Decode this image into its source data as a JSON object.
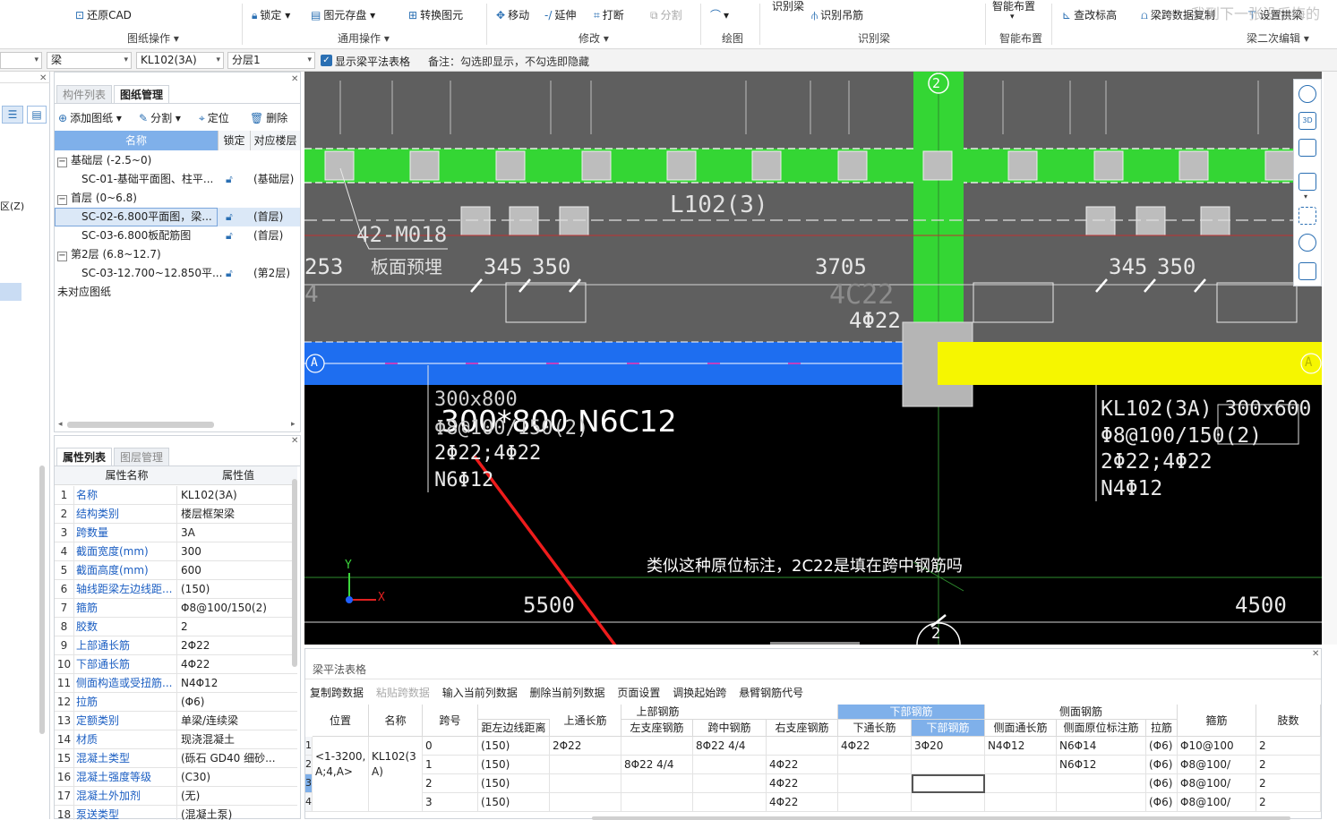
{
  "ribbon": {
    "buttons": {
      "restore_cad": "还原CAD",
      "lock": "锁定",
      "save_element": "图元存盘",
      "convert_element": "转换图元",
      "move": "移动",
      "extend": "延伸",
      "break": "打断",
      "split": "分割",
      "identify_beam_top": "识别梁",
      "identify_hanger": "识别吊筋",
      "smart_layout_top": "智能布置",
      "check_elevation": "查改标高",
      "beam_span": "梁跨数据复制",
      "set_support": "设置拱梁"
    },
    "groups": {
      "drawing_ops": "图纸操作",
      "common_ops": "通用操作",
      "modify": "修改",
      "draw": "绘图",
      "identify_beam": "识别梁",
      "smart_layout": "智能布置",
      "beam_secondary_edit": "梁二次编辑"
    },
    "watermark": "我到下一张没后悔的"
  },
  "filter": {
    "combo1": "",
    "combo2": "梁",
    "combo3": "KL102(3A)",
    "combo4": "分层1",
    "checkbox_label": "显示梁平法表格",
    "note": "备注：勾选即显示，不勾选即隐藏"
  },
  "left_stub": {
    "label": "区(Z)"
  },
  "drawing_panel": {
    "tabs": [
      "构件列表",
      "图纸管理"
    ],
    "toolbar": {
      "add": "添加图纸",
      "split": "分割",
      "locate": "定位",
      "delete": "删除"
    },
    "headers": {
      "name": "名称",
      "lock": "锁定",
      "floor": "对应楼层"
    },
    "rows": [
      {
        "name": "基础层 (-2.5~0)",
        "floor": ""
      },
      {
        "name": "SC-01-基础平面图、柱平...",
        "floor": "(基础层)"
      },
      {
        "name": "首层 (0~6.8)",
        "floor": ""
      },
      {
        "name": "SC-02-6.800平面图，梁...",
        "floor": "(首层)"
      },
      {
        "name": "SC-03-6.800板配筋图",
        "floor": "(首层)"
      },
      {
        "name": "第2层 (6.8~12.7)",
        "floor": ""
      },
      {
        "name": "SC-03-12.700~12.850平...",
        "floor": "(第2层)"
      },
      {
        "name": "未对应图纸",
        "floor": ""
      }
    ]
  },
  "prop_panel": {
    "tabs": [
      "属性列表",
      "图层管理"
    ],
    "headers": {
      "name": "属性名称",
      "value": "属性值"
    },
    "rows": [
      {
        "n": "1",
        "k": "名称",
        "v": "KL102(3A)"
      },
      {
        "n": "2",
        "k": "结构类别",
        "v": "楼层框架梁"
      },
      {
        "n": "3",
        "k": "跨数量",
        "v": "3A"
      },
      {
        "n": "4",
        "k": "截面宽度(mm)",
        "v": "300"
      },
      {
        "n": "5",
        "k": "截面高度(mm)",
        "v": "600"
      },
      {
        "n": "6",
        "k": "轴线距梁左边线距...",
        "v": "(150)"
      },
      {
        "n": "7",
        "k": "箍筋",
        "v": "Φ8@100/150(2)"
      },
      {
        "n": "8",
        "k": "胶数",
        "v": "2"
      },
      {
        "n": "9",
        "k": "上部通长筋",
        "v": "2Φ22"
      },
      {
        "n": "10",
        "k": "下部通长筋",
        "v": "4Φ22"
      },
      {
        "n": "11",
        "k": "侧面构造或受扭筋...",
        "v": "N4Φ12"
      },
      {
        "n": "12",
        "k": "拉筋",
        "v": "(Φ6)"
      },
      {
        "n": "13",
        "k": "定额类别",
        "v": "单梁/连续梁"
      },
      {
        "n": "14",
        "k": "材质",
        "v": "现浇混凝土"
      },
      {
        "n": "15",
        "k": "混凝土类型",
        "v": "(砾石 GD40 细砂..."
      },
      {
        "n": "16",
        "k": "混凝土强度等级",
        "v": "(C30)"
      },
      {
        "n": "17",
        "k": "混凝土外加剂",
        "v": "(无)"
      },
      {
        "n": "18",
        "k": "泵送类型",
        "v": "(混凝土泵)"
      }
    ]
  },
  "cad": {
    "axis_top": "2",
    "axis_bottom": "2",
    "axis_left": "A",
    "axis_right": "A",
    "beam_l102": "L102(3)",
    "m018": "42-M018",
    "board_embed": "板面预埋",
    "dim_253": "253",
    "dim_345a": "345",
    "dim_350a": "350",
    "dim_3705": "3705",
    "dim_345b": "345",
    "dim_350b": "350",
    "c22_ghost": "4C22",
    "phi22": "4Φ22",
    "left_4": "4",
    "ann_left_1": "300x800",
    "ann_left_big": "300*800 N6C12",
    "ann_left_2": "Φ8@100/150(2)",
    "ann_left_3": "2Φ22;4Φ22",
    "ann_left_4": "N6Φ12",
    "ann_right_1": "KL102(3A) 300x600",
    "ann_right_2": "Φ8@100/150(2)",
    "ann_right_3": "2Φ22;4Φ22",
    "ann_right_4": "N4Φ12",
    "question": "类似这种原位标注，2C22是填在跨中钢筋吗",
    "dim_5500": "5500",
    "dim_4500": "4500",
    "axis_y": "Y",
    "axis_x": "X"
  },
  "beam_table": {
    "title": "梁平法表格",
    "toolbar": [
      "复制跨数据",
      "粘贴跨数据",
      "输入当前列数据",
      "删除当前列数据",
      "页面设置",
      "调换起始跨",
      "悬臂钢筋代号"
    ],
    "group_headers": {
      "top": "上部钢筋",
      "bottom": "下部钢筋",
      "side": "侧面钢筋"
    },
    "headers": {
      "pos": "位置",
      "name": "名称",
      "span": "跨号",
      "left_dist": "距左边线距离",
      "top_through": "上通长筋",
      "left_support": "左支座钢筋",
      "mid": "跨中钢筋",
      "right_support": "右支座钢筋",
      "bot_through": "下通长筋",
      "bot_bar": "下部钢筋",
      "side_through": "侧面通长筋",
      "side_orig": "侧面原位标注筋",
      "tie": "拉筋",
      "stirrup": "箍筋",
      "legs": "肢数"
    },
    "pos_value": "<1-3200,A;4,A>",
    "name_value": "KL102(3A)",
    "rows": [
      {
        "idx": "1",
        "span": "0",
        "dist": "(150)",
        "top": "2Φ22",
        "left": "",
        "mid": "8Φ22 4/4",
        "right": "",
        "bthru": "4Φ22",
        "bbar": "3Φ20",
        "sthru": "N4Φ12",
        "sorig": "N6Φ14",
        "tie": "(Φ6)",
        "stir": "Φ10@100",
        "legs": "2"
      },
      {
        "idx": "2",
        "span": "1",
        "dist": "(150)",
        "top": "",
        "left": "8Φ22 4/4",
        "mid": "",
        "right": "4Φ22",
        "bthru": "",
        "bbar": "",
        "sthru": "",
        "sorig": "N6Φ12",
        "tie": "(Φ6)",
        "stir": "Φ8@100/",
        "legs": "2"
      },
      {
        "idx": "3",
        "span": "2",
        "dist": "(150)",
        "top": "",
        "left": "",
        "mid": "",
        "right": "4Φ22",
        "bthru": "",
        "bbar": "",
        "sthru": "",
        "sorig": "",
        "tie": "(Φ6)",
        "stir": "Φ8@100/",
        "legs": "2"
      },
      {
        "idx": "4",
        "span": "3",
        "dist": "(150)",
        "top": "",
        "left": "",
        "mid": "",
        "right": "4Φ22",
        "bthru": "",
        "bbar": "",
        "sthru": "",
        "sorig": "",
        "tie": "(Φ6)",
        "stir": "Φ8@100/",
        "legs": "2"
      }
    ]
  }
}
